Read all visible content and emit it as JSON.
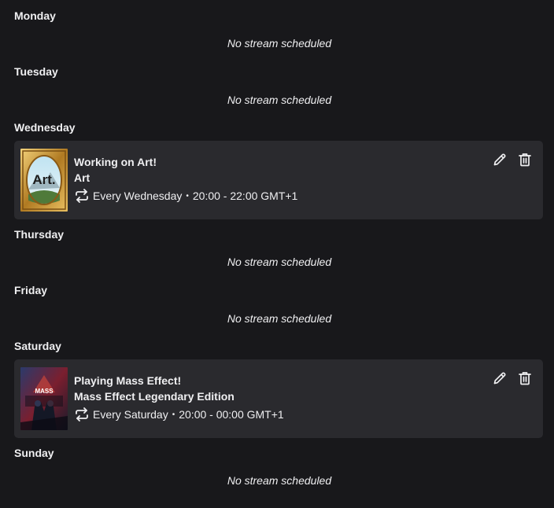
{
  "days": [
    {
      "name": "Monday",
      "empty_text": "No stream scheduled"
    },
    {
      "name": "Tuesday",
      "empty_text": "No stream scheduled"
    },
    {
      "name": "Wednesday"
    },
    {
      "name": "Thursday",
      "empty_text": "No stream scheduled"
    },
    {
      "name": "Friday",
      "empty_text": "No stream scheduled"
    },
    {
      "name": "Saturday"
    },
    {
      "name": "Sunday",
      "empty_text": "No stream scheduled"
    }
  ],
  "segments": [
    {
      "title": "Working on Art!",
      "category": "Art",
      "recurrence": "Every Wednesday",
      "time": "20:00 - 22:00 GMT+1",
      "thumbnail_text": "Art.",
      "icons": [
        "repeat-icon",
        "pencil-icon",
        "trash-icon"
      ]
    },
    {
      "title": "Playing Mass Effect!",
      "category": "Mass Effect Legendary Edition",
      "recurrence": "Every Saturday",
      "time": "20:00 - 00:00 GMT+1",
      "thumbnail_text": "MASS",
      "icons": [
        "repeat-icon",
        "pencil-icon",
        "trash-icon"
      ]
    }
  ],
  "separator": "•",
  "colors": {
    "background": "#18181b",
    "card": "#2a2a2e",
    "text": "#efeff1"
  }
}
